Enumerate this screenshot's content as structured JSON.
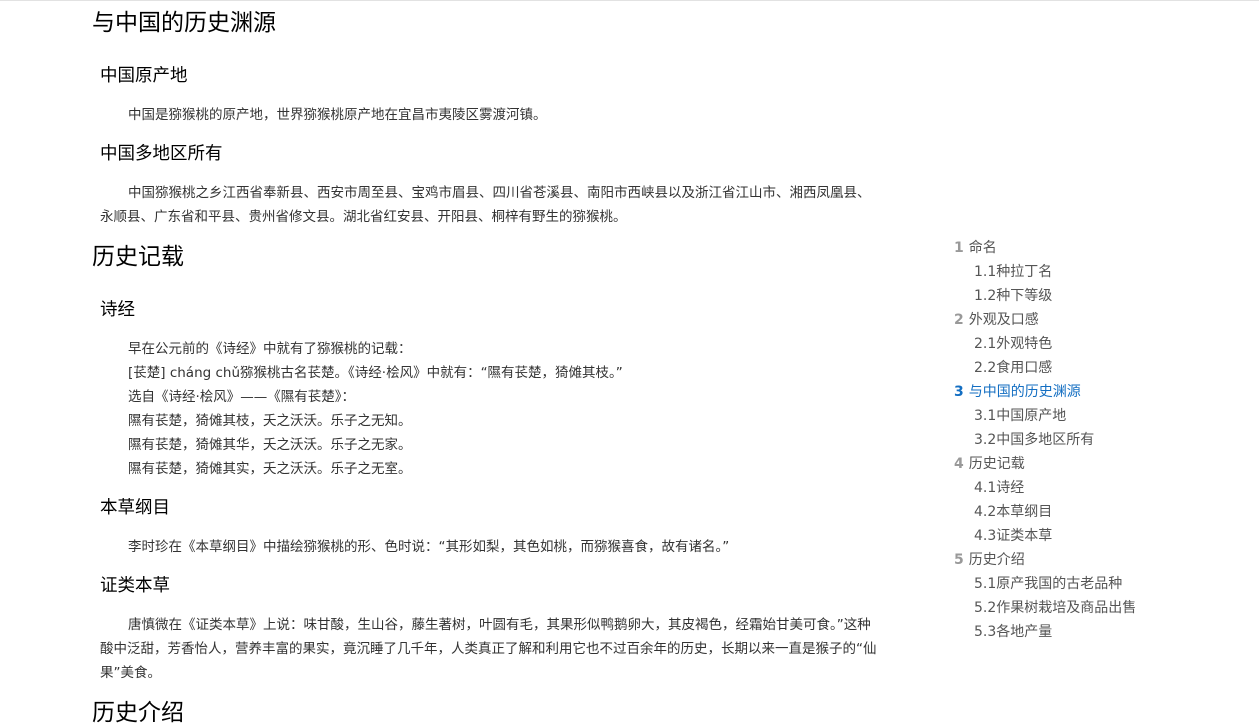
{
  "article": {
    "section_history_origin": "与中国的历史渊源",
    "sub_origin_place": "中国原产地",
    "para_origin_place": "中国是猕猴桃的原产地，世界猕猴桃原产地在宜昌市夷陵区雾渡河镇。",
    "sub_regions": "中国多地区所有",
    "para_regions_line1": "中国猕猴桃之乡江西省奉新县、西安市周至县、宝鸡市眉县、四川省苍溪县、南阳市西峡县以及浙江省江山市、湘西凤凰县、",
    "para_regions_line2": "永顺县、广东省和平县、贵州省修文县。湖北省红安县、开阳县、桐梓有野生的猕猴桃。",
    "section_records": "历史记载",
    "sub_shijing": "诗经",
    "shijing_lines": [
      "早在公元前的《诗经》中就有了猕猴桃的记载：",
      "[苌楚] cháng chǔ猕猴桃古名苌楚。《诗经·桧风》中就有：“隰有苌楚，猗傩其枝。”",
      "选自《诗经·桧风》——《隰有苌楚》：",
      "隰有苌楚，猗傩其枝，夭之沃沃。乐子之无知。",
      "隰有苌楚，猗傩其华，夭之沃沃。乐子之无家。",
      "隰有苌楚，猗傩其实，夭之沃沃。乐子之无室。"
    ],
    "sub_bencao": "本草纲目",
    "para_bencao": "李时珍在《本草纲目》中描绘猕猴桃的形、色时说：“其形如梨，其色如桃，而猕猴喜食，故有诸名。”",
    "sub_zhenglei": "证类本草",
    "para_zhenglei_line1": "唐慎微在《证类本草》上说：味甘酸，生山谷，藤生著树，叶圆有毛，其果形似鸭鹅卵大，其皮褐色，经霜始甘美可食。”这种",
    "para_zhenglei_line2": "酸中泛甜，芳香怡人，营养丰富的果实，竟沉睡了几千年，人类真正了解和利用它也不过百余年的历史，长期以来一直是猴子的“仙",
    "para_zhenglei_line3": "果”美食。",
    "section_intro": "历史介绍"
  },
  "toc": {
    "items": [
      {
        "num": "1",
        "label": "命名"
      },
      {
        "num": "",
        "label": "1.1种拉丁名"
      },
      {
        "num": "",
        "label": "1.2种下等级"
      },
      {
        "num": "2",
        "label": "外观及口感"
      },
      {
        "num": "",
        "label": "2.1外观特色"
      },
      {
        "num": "",
        "label": "2.2食用口感"
      },
      {
        "num": "3",
        "label": "与中国的历史渊源"
      },
      {
        "num": "",
        "label": "3.1中国原产地"
      },
      {
        "num": "",
        "label": "3.2中国多地区所有"
      },
      {
        "num": "4",
        "label": "历史记载"
      },
      {
        "num": "",
        "label": "4.1诗经"
      },
      {
        "num": "",
        "label": "4.2本草纲目"
      },
      {
        "num": "",
        "label": "4.3证类本草"
      },
      {
        "num": "5",
        "label": "历史介绍"
      },
      {
        "num": "",
        "label": "5.1原产我国的古老品种"
      },
      {
        "num": "",
        "label": "5.2作果树栽培及商品出售"
      },
      {
        "num": "",
        "label": "5.3各地产量"
      }
    ],
    "active_label": "与中国的历史渊源"
  },
  "colors": {
    "heading": "#000000",
    "text": "#333333",
    "toc_text": "#555555",
    "toc_number": "#999999",
    "toc_active": "#136ec2"
  }
}
